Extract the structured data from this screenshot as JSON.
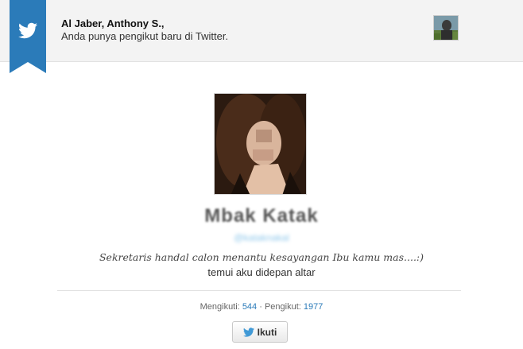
{
  "notification": {
    "title": "Al Jaber, Anthony S.,",
    "subtitle": "Anda punya pengikut baru di Twitter."
  },
  "profile": {
    "display_name": "Mbak Katak",
    "handle": "@kataknakal",
    "bio_line1": "Sekretaris handal calon menantu kesayangan Ibu kamu mas....:)",
    "bio_line2": "temui aku didepan altar"
  },
  "stats": {
    "following_label": "Mengikuti:",
    "following_count": "544",
    "separator": "·",
    "followers_label": "Pengikut:",
    "followers_count": "1977"
  },
  "follow_button": {
    "label": "Ikuti"
  },
  "colors": {
    "ribbon": "#2b7bb9",
    "link": "#2b7bb9",
    "twitter_bird": "#4099d6"
  },
  "icons": {
    "ribbon": "twitter-bird-icon",
    "button": "twitter-bird-icon"
  }
}
